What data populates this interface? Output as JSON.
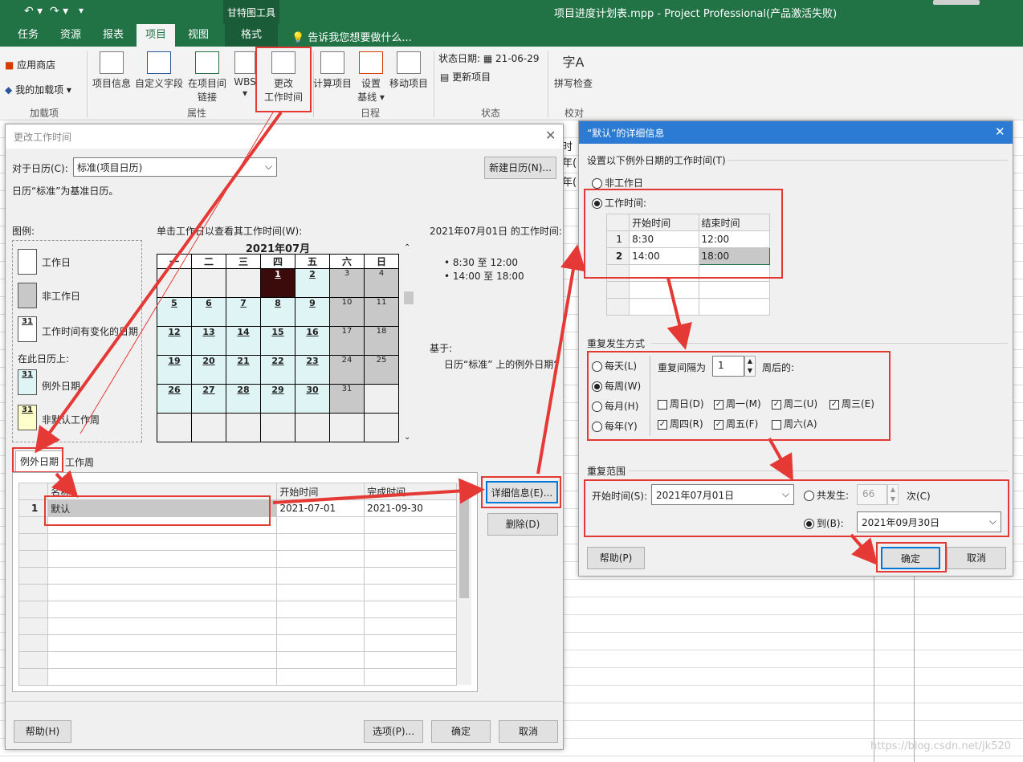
{
  "title_bar": {
    "text": "项目进度计划表.mpp - Project Professional(产品激活失败)",
    "contextual": "甘特图工具"
  },
  "tabs": [
    "任务",
    "资源",
    "报表",
    "项目",
    "视图",
    "格式"
  ],
  "tell_me": "告诉我您想要做什么...",
  "ribbon": {
    "addins": {
      "store": "应用商店",
      "my_addins": "我的加载项",
      "group": "加载项"
    },
    "props": {
      "info": "项目信息",
      "custom": "自定义字段",
      "link_l1": "在项目间",
      "link_l2": "链接",
      "wbs": "WBS",
      "change_l1": "更改",
      "change_l2": "工作时间",
      "group": "属性"
    },
    "schedule": {
      "calc": "计算项目",
      "baseline_l1": "设置",
      "baseline_l2": "基线",
      "move": "移动项目",
      "group": "日程"
    },
    "status": {
      "date_label": "状态日期:",
      "date_value": "21-06-29",
      "update": "更新项目",
      "group": "状态"
    },
    "proof": {
      "spell": "拼写检查",
      "group": "校对"
    }
  },
  "cwt": {
    "title": "更改工作时间",
    "for_cal_label": "对于日历(C):",
    "for_cal_value": "标准(项目日历)",
    "new_cal": "新建日历(N)...",
    "base_note": "日历“标准”为基准日历。",
    "legend_title": "图例:",
    "legend": [
      "工作日",
      "非工作日",
      "工作时间有变化的日期",
      "例外日期",
      "非默认工作周"
    ],
    "on_this_cal": "在此日历上:",
    "click_note": "单击工作日以查看其工作时间(W):",
    "month": "2021年07月",
    "weekdays": [
      "一",
      "二",
      "三",
      "四",
      "五",
      "六",
      "日"
    ],
    "work_title": "2021年07月01日 的工作时间:",
    "work_times": [
      "• 8:30 至 12:00",
      "• 14:00 至 18:00"
    ],
    "based_on": "基于:",
    "based_text": "日历“标准” 上的例外日期“",
    "tab_exceptions": "例外日期",
    "tab_workweek": "工作周",
    "cols": [
      "名称",
      "开始时间",
      "完成时间"
    ],
    "rows": [
      {
        "num": "1",
        "name": "默认",
        "start": "2021-07-01",
        "end": "2021-09-30"
      }
    ],
    "details_btn": "详细信息(E)...",
    "delete_btn": "删除(D)",
    "help_btn": "帮助(H)",
    "options_btn": "选项(P)...",
    "ok_btn": "确定",
    "cancel_btn": "取消"
  },
  "det": {
    "title": "“默认”的详细信息",
    "set_label": "设置以下例外日期的工作时间(T)",
    "nonwork": "非工作日",
    "worktime": "工作时间:",
    "cols": [
      "开始时间",
      "结束时间"
    ],
    "rows": [
      {
        "n": "1",
        "s": "8:30",
        "e": "12:00"
      },
      {
        "n": "2",
        "s": "14:00",
        "e": "18:00"
      }
    ],
    "recur_title": "重复发生方式",
    "freq": [
      "每天(L)",
      "每周(W)",
      "每月(H)",
      "每年(Y)"
    ],
    "every_label": "重复间隔为",
    "every_value": "1",
    "weeks_on": "周后的:",
    "days": [
      {
        "l": "周日(D)",
        "c": false
      },
      {
        "l": "周一(M)",
        "c": true
      },
      {
        "l": "周二(U)",
        "c": true
      },
      {
        "l": "周三(E)",
        "c": true
      },
      {
        "l": "周四(R)",
        "c": true
      },
      {
        "l": "周五(F)",
        "c": true
      },
      {
        "l": "周六(A)",
        "c": false
      }
    ],
    "range_title": "重复范围",
    "start_label": "开始时间(S):",
    "start_value": "2021年07月01日",
    "occur_label": "共发生:",
    "occur_value": "66",
    "times": "次(C)",
    "to_label": "到(B):",
    "to_value": "2021年09月30日",
    "help_btn": "帮助(P)",
    "ok_btn": "确定",
    "cancel_btn": "取消"
  },
  "bg": {
    "peek1": "时",
    "peek2": "年(",
    "peek3": "年("
  },
  "watermark": "https://blog.csdn.net/jk520"
}
